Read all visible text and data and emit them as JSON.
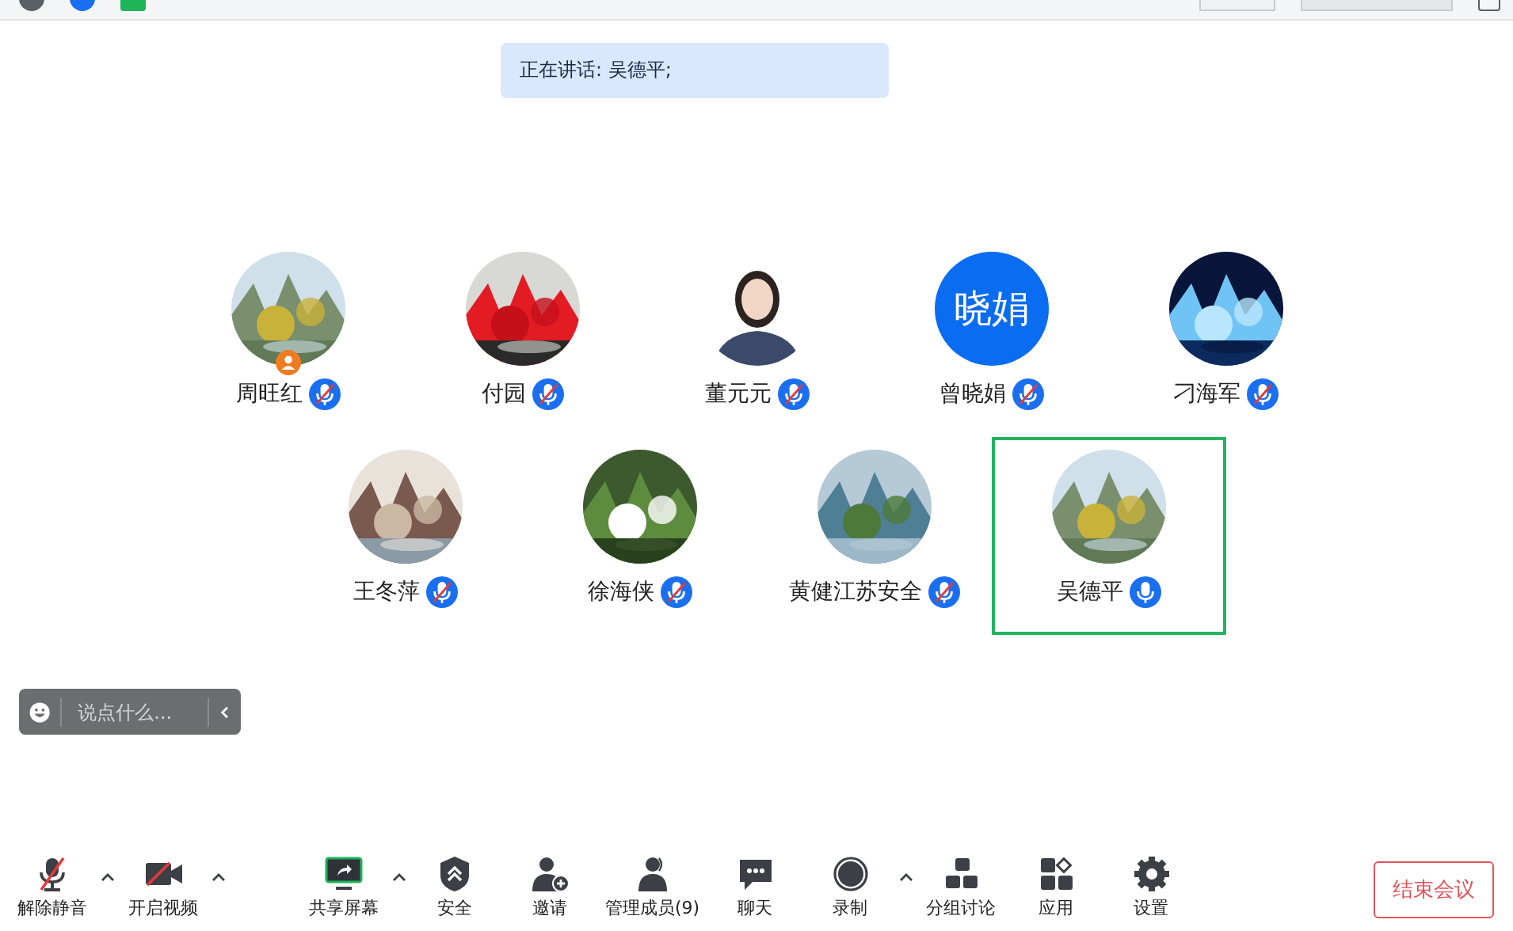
{
  "speaking_banner": "正在讲话: 吴德平;",
  "participants": [
    {
      "name": "周旺红",
      "muted": true,
      "host": true,
      "active": false
    },
    {
      "name": "付园",
      "muted": true,
      "host": false,
      "active": false
    },
    {
      "name": "董元元",
      "muted": true,
      "host": false,
      "active": false
    },
    {
      "name": "曾晓娟",
      "muted": true,
      "host": false,
      "active": false,
      "avatar": {
        "kind": "text",
        "text": "晓娟"
      }
    },
    {
      "name": "刁海军",
      "muted": true,
      "host": false,
      "active": false
    },
    {
      "name": "王冬萍",
      "muted": true,
      "host": false,
      "active": false
    },
    {
      "name": "徐海侠",
      "muted": true,
      "host": false,
      "active": false
    },
    {
      "name": "黄健江苏安全",
      "muted": true,
      "host": false,
      "active": false
    },
    {
      "name": "吴德平",
      "muted": false,
      "host": false,
      "active": true
    }
  ],
  "chat_bar": {
    "placeholder": "说点什么..."
  },
  "toolbar": [
    {
      "kind": "mic",
      "label": "解除静音",
      "caret": true
    },
    {
      "kind": "video",
      "label": "开启视频",
      "caret": true
    },
    {
      "kind": "share",
      "label": "共享屏幕",
      "caret": true
    },
    {
      "kind": "security",
      "label": "安全",
      "caret": false
    },
    {
      "kind": "invite",
      "label": "邀请",
      "caret": false
    },
    {
      "kind": "members",
      "label": "管理成员(9)",
      "caret": false
    },
    {
      "kind": "chat",
      "label": "聊天",
      "caret": false
    },
    {
      "kind": "record",
      "label": "录制",
      "caret": true
    },
    {
      "kind": "breakout",
      "label": "分组讨论",
      "caret": false
    },
    {
      "kind": "apps",
      "label": "应用",
      "caret": false
    },
    {
      "kind": "settings",
      "label": "设置",
      "caret": false
    }
  ],
  "end_button": "结束会议"
}
